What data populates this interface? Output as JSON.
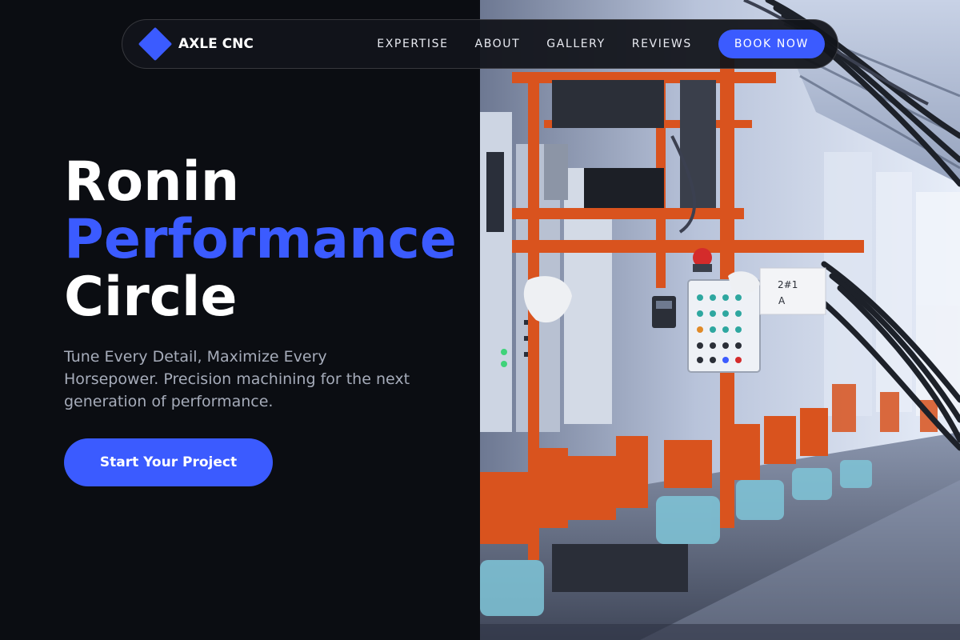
{
  "brand": {
    "name": "AXLE CNC",
    "logo_icon": "diamond-logo-icon",
    "accent_color": "#3b5bff"
  },
  "nav": {
    "links": [
      "EXPERTISE",
      "ABOUT",
      "GALLERY",
      "REVIEWS"
    ],
    "cta": "BOOK NOW"
  },
  "hero": {
    "title_line1": "Ronin",
    "title_line2": "Performance",
    "title_line3": "Circle",
    "subtitle": "Tune Every Detail, Maximize Every Horsepower. Precision machining for the next generation of performance.",
    "cta": "Start Your Project"
  },
  "image": {
    "panel_label_1": "2#1",
    "panel_label_2": "A"
  },
  "colors": {
    "background": "#0b0d12",
    "accent": "#3b5bff",
    "text_primary": "#ffffff",
    "text_muted": "#a6acba",
    "machine_orange": "#d9531e"
  }
}
